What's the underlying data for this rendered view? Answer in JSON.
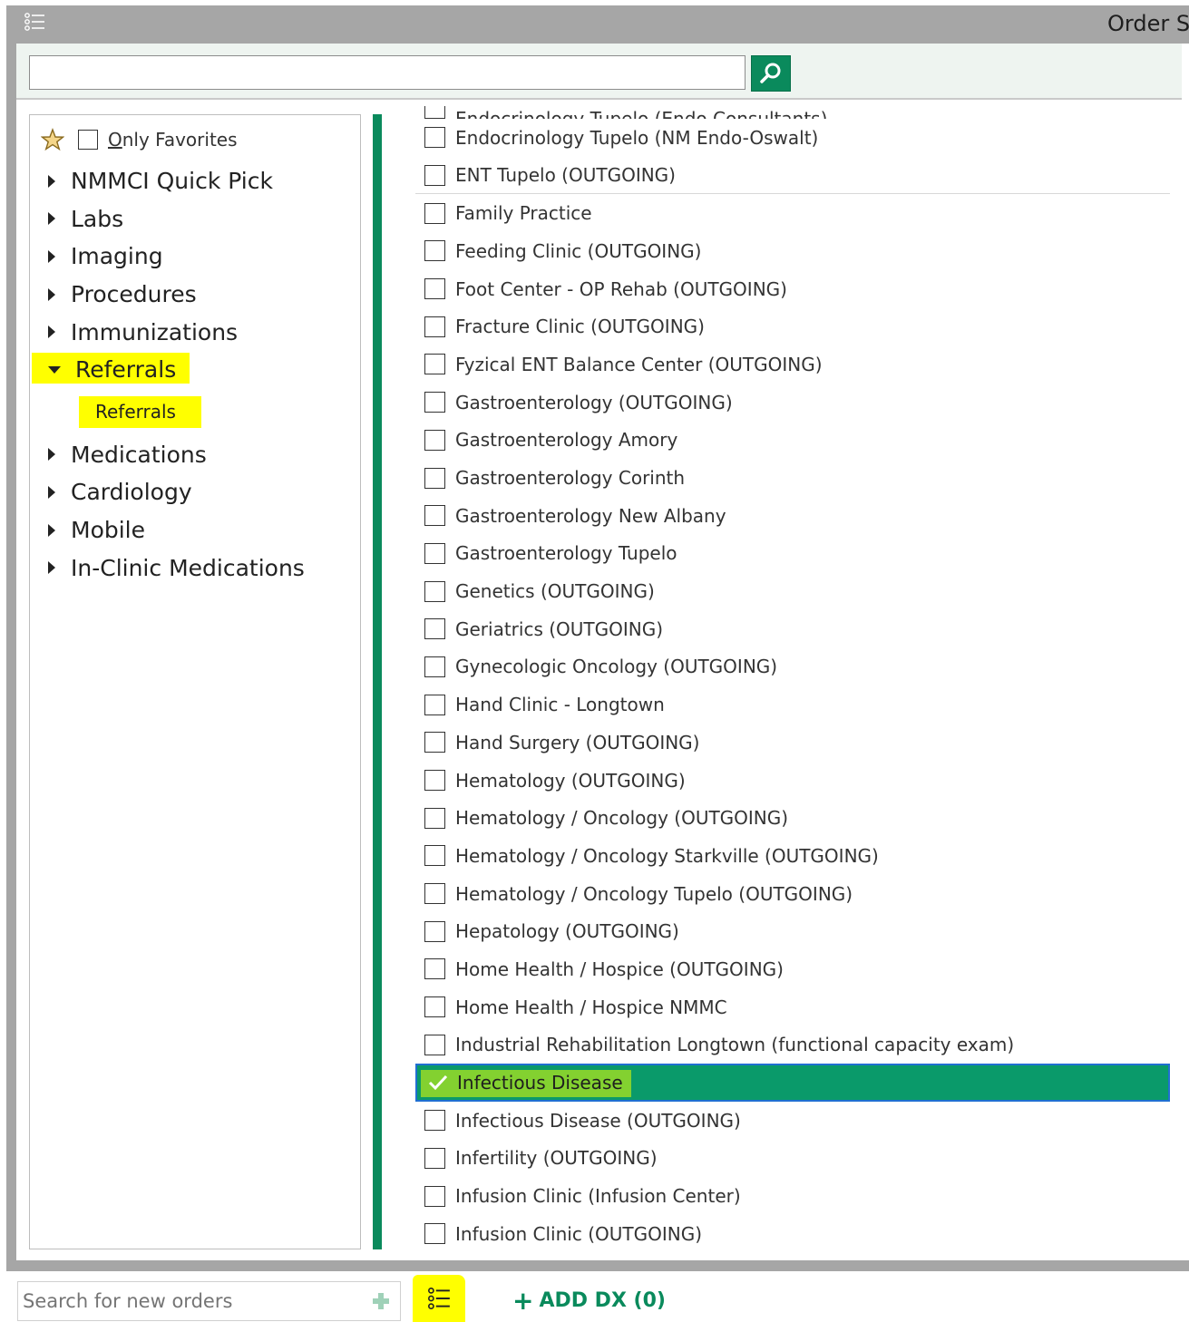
{
  "window": {
    "title": "Order S",
    "menu_icon": "list-menu-icon"
  },
  "search": {
    "value": "",
    "placeholder": "",
    "button_icon": "search-icon"
  },
  "favorites": {
    "label_prefix": "O",
    "label_rest": "nly Favorites",
    "checked": false,
    "icon": "star-icon"
  },
  "tree": {
    "items": [
      {
        "label": "NMMCI Quick Pick",
        "expanded": false
      },
      {
        "label": "Labs",
        "expanded": false
      },
      {
        "label": "Imaging",
        "expanded": false
      },
      {
        "label": "Procedures",
        "expanded": false
      },
      {
        "label": "Immunizations",
        "expanded": false
      },
      {
        "label": "Referrals",
        "expanded": true,
        "child": "Referrals"
      },
      {
        "label": "Medications",
        "expanded": false
      },
      {
        "label": "Cardiology",
        "expanded": false
      },
      {
        "label": "Mobile",
        "expanded": false
      },
      {
        "label": "In-Clinic Medications",
        "expanded": false
      }
    ]
  },
  "orders": {
    "top_cut_item": "Endocrinology Tupelo (Endo Consultants)",
    "items": [
      "Endocrinology Tupelo (NM Endo-Oswalt)",
      "ENT Tupelo (OUTGOING)",
      "Family Practice",
      "Feeding Clinic (OUTGOING)",
      "Foot Center - OP Rehab (OUTGOING)",
      "Fracture Clinic (OUTGOING)",
      "Fyzical ENT Balance Center (OUTGOING)",
      "Gastroenterology (OUTGOING)",
      "Gastroenterology Amory",
      "Gastroenterology Corinth",
      "Gastroenterology New Albany",
      "Gastroenterology Tupelo",
      "Genetics (OUTGOING)",
      "Geriatrics (OUTGOING)",
      "Gynecologic Oncology (OUTGOING)",
      "Hand Clinic - Longtown",
      "Hand Surgery (OUTGOING)",
      "Hematology (OUTGOING)",
      "Hematology / Oncology (OUTGOING)",
      "Hematology / Oncology Starkville (OUTGOING)",
      "Hematology / Oncology Tupelo (OUTGOING)",
      "Hepatology (OUTGOING)",
      "Home Health / Hospice (OUTGOING)",
      "Home Health / Hospice NMMC",
      "Industrial Rehabilitation Longtown (functional capacity exam)",
      "Infectious Disease",
      "Infectious Disease (OUTGOING)",
      "Infertility (OUTGOING)",
      "Infusion Clinic (Infusion Center)",
      "Infusion Clinic (OUTGOING)"
    ],
    "selected": "Infectious Disease"
  },
  "footer": {
    "search_placeholder": "Search for new orders",
    "add_icon": "plus-icon",
    "orders_icon": "order-list-icon",
    "add_dx_label": "ADD DX (0)"
  },
  "colors": {
    "accent": "#0a8a5c",
    "selected_row": "#0a9a6a",
    "highlight": "#ffff00",
    "chrome": "#a6a6a6"
  }
}
